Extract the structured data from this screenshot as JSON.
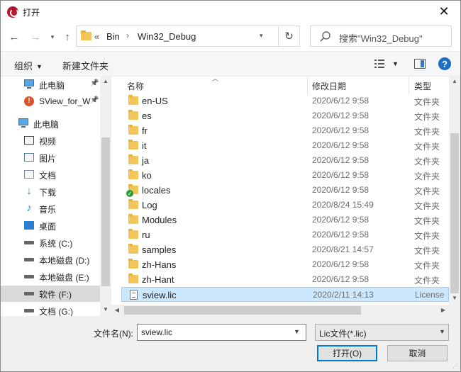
{
  "window": {
    "title": "打开"
  },
  "address": {
    "overflow": "«",
    "crumbs": [
      "Bin",
      "Win32_Debug"
    ]
  },
  "search": {
    "placeholder": "搜索\"Win32_Debug\""
  },
  "toolbar": {
    "organize": "组织",
    "new_folder": "新建文件夹"
  },
  "nav": {
    "items": [
      {
        "label": "此电脑",
        "icon": "computer-icon",
        "pinned": true
      },
      {
        "label": "SView_for_W",
        "icon": "app-shortcut-icon",
        "pinned": true
      },
      {
        "label": "此电脑",
        "icon": "computer-icon",
        "pinned": false
      },
      {
        "label": "视频",
        "icon": "video-folder-icon"
      },
      {
        "label": "图片",
        "icon": "pictures-folder-icon"
      },
      {
        "label": "文档",
        "icon": "documents-folder-icon"
      },
      {
        "label": "下载",
        "icon": "downloads-folder-icon"
      },
      {
        "label": "音乐",
        "icon": "music-folder-icon"
      },
      {
        "label": "桌面",
        "icon": "desktop-folder-icon"
      },
      {
        "label": "系统 (C:)",
        "icon": "system-drive-icon"
      },
      {
        "label": "本地磁盘 (D:)",
        "icon": "drive-icon"
      },
      {
        "label": "本地磁盘 (E:)",
        "icon": "drive-icon"
      },
      {
        "label": "软件 (F:)",
        "icon": "drive-icon",
        "selected": true
      },
      {
        "label": "文档 (G:)",
        "icon": "drive-icon"
      }
    ]
  },
  "columns": {
    "name": "名称",
    "date": "修改日期",
    "type": "类型"
  },
  "files": [
    {
      "name": "en-US",
      "date": "2020/6/12 9:58",
      "type": "文件夹",
      "kind": "folder"
    },
    {
      "name": "es",
      "date": "2020/6/12 9:58",
      "type": "文件夹",
      "kind": "folder"
    },
    {
      "name": "fr",
      "date": "2020/6/12 9:58",
      "type": "文件夹",
      "kind": "folder"
    },
    {
      "name": "it",
      "date": "2020/6/12 9:58",
      "type": "文件夹",
      "kind": "folder"
    },
    {
      "name": "ja",
      "date": "2020/6/12 9:58",
      "type": "文件夹",
      "kind": "folder"
    },
    {
      "name": "ko",
      "date": "2020/6/12 9:58",
      "type": "文件夹",
      "kind": "folder"
    },
    {
      "name": "locales",
      "date": "2020/6/12 9:58",
      "type": "文件夹",
      "kind": "folder-synced"
    },
    {
      "name": "Log",
      "date": "2020/8/24 15:49",
      "type": "文件夹",
      "kind": "folder"
    },
    {
      "name": "Modules",
      "date": "2020/6/12 9:58",
      "type": "文件夹",
      "kind": "folder"
    },
    {
      "name": "ru",
      "date": "2020/6/12 9:58",
      "type": "文件夹",
      "kind": "folder"
    },
    {
      "name": "samples",
      "date": "2020/8/21 14:57",
      "type": "文件夹",
      "kind": "folder"
    },
    {
      "name": "zh-Hans",
      "date": "2020/6/12 9:58",
      "type": "文件夹",
      "kind": "folder"
    },
    {
      "name": "zh-Hant",
      "date": "2020/6/12 9:58",
      "type": "文件夹",
      "kind": "folder"
    },
    {
      "name": "sview.lic",
      "date": "2020/2/11 14:13",
      "type": "License",
      "kind": "file",
      "selected": true
    }
  ],
  "footer": {
    "filename_label": "文件名(N):",
    "filename_value": "sview.lic",
    "filter_value": "Lic文件(*.lic)",
    "open_label": "打开(O)",
    "cancel_label": "取消"
  }
}
